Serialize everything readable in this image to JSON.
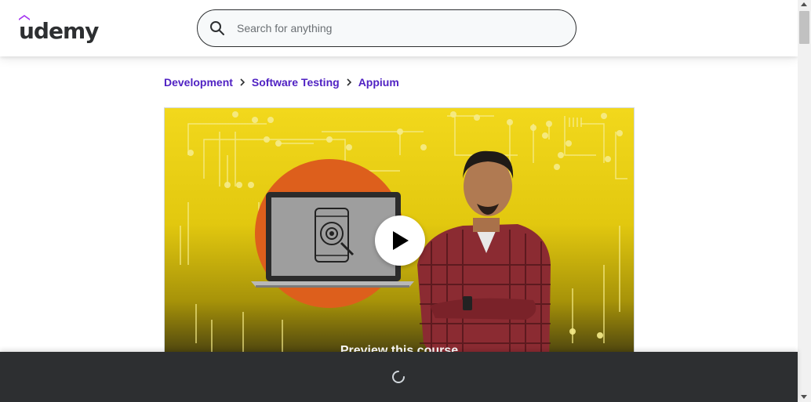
{
  "header": {
    "logo_text": "udemy",
    "search": {
      "placeholder": "Search for anything",
      "value": ""
    }
  },
  "breadcrumb": {
    "items": [
      {
        "label": "Development"
      },
      {
        "label": "Software Testing"
      },
      {
        "label": "Appium"
      }
    ]
  },
  "preview": {
    "label": "Preview this course"
  },
  "colors": {
    "brand_purple": "#a435f0",
    "link_purple": "#5022c3",
    "dark": "#2d2f31",
    "thumbnail_yellow": "#f2d81c",
    "thumbnail_orange": "#dd5f1c"
  },
  "icons": {
    "logo_hat": "udemy-hat-icon",
    "search": "search-icon",
    "breadcrumb_separator": "chevron-right-icon",
    "play": "play-icon",
    "loading": "loading-spinner-icon"
  }
}
